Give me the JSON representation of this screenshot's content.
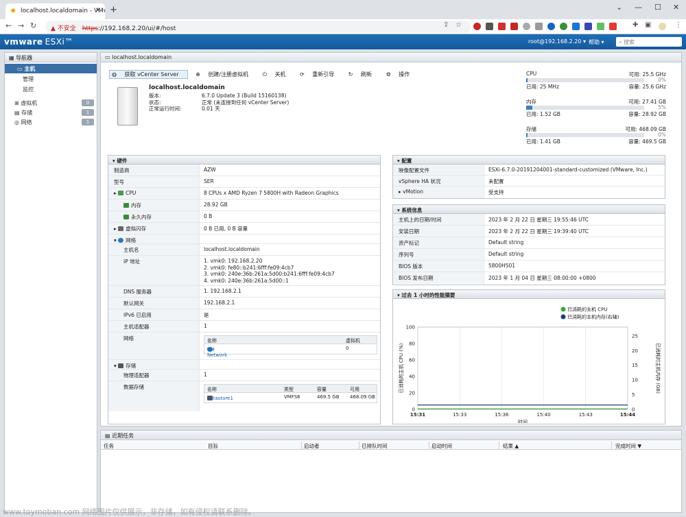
{
  "browser": {
    "tab_title": "localhost.localdomain - VMw",
    "insecure_label": "不安全",
    "url_scheme": "https",
    "url_rest": "://192.168.2.20/ui/#/host"
  },
  "header": {
    "logo": "vmware",
    "product": "ESXi™",
    "user": "root@192.168.2.20 ▾",
    "help": "帮助 ▾",
    "search_placeholder": "搜索"
  },
  "navigator": {
    "title": "导航器",
    "items": [
      {
        "label": "主机"
      },
      {
        "label": "管理"
      },
      {
        "label": "监控"
      }
    ],
    "groups": [
      {
        "label": "虚拟机",
        "count": "0"
      },
      {
        "label": "存储",
        "count": "1"
      },
      {
        "label": "网络",
        "count": "1"
      }
    ]
  },
  "main": {
    "title": "localhost.localdomain",
    "toolbar": [
      "获取 vCenter Server",
      "创建/注册虚拟机",
      "关机",
      "重新引导",
      "刷新",
      "操作"
    ],
    "host": {
      "name": "localhost.localdomain",
      "version_key": "版本:",
      "version": "6.7.0 Update 3 (Build 15160138)",
      "state_key": "状态:",
      "state": "正常 (未连接到任何 vCenter Server)",
      "uptime_key": "正常运行时间:",
      "uptime": "0.01 天"
    },
    "resources": [
      {
        "name": "CPU",
        "free": "可用: 25.5 GHz",
        "used": "已用: 25 MHz",
        "capacity": "容量: 25.6 GHz",
        "pct": "0%",
        "fraction": 0.01
      },
      {
        "name": "内存",
        "free": "可用: 27.41 GB",
        "used": "已用: 1.52 GB",
        "capacity": "容量: 28.92 GB",
        "pct": "5%",
        "fraction": 0.05
      },
      {
        "name": "存储",
        "free": "可用: 468.09 GB",
        "used": "已用: 1.41 GB",
        "capacity": "容量: 469.5 GB",
        "pct": "0%",
        "fraction": 0.01
      }
    ]
  },
  "hardware": {
    "title": "硬件",
    "rows": [
      [
        "制造商",
        "AZW"
      ],
      [
        "型号",
        "SER"
      ],
      [
        "CPU",
        "8 CPUs x AMD Ryzen 7 5800H with Radeon Graphics"
      ],
      [
        "内存",
        "28.92 GB"
      ],
      [
        "永久内存",
        "0 B"
      ],
      [
        "虚拟闪存",
        "0 B 已用, 0 B 容量"
      ],
      [
        "网络",
        ""
      ],
      [
        "主机名",
        "localhost.localdomain"
      ]
    ],
    "ip_key": "IP 地址",
    "ips": [
      "1. vmk0: 192.168.2.20",
      "2. vmk0: fe80::b241:6fff:fe09:4cb7",
      "3. vmk0: 240e:36b:261a:5d00:b241:6fff:fe09:4cb7",
      "4. vmk0: 240e:36b:261a:5d00::1"
    ],
    "rows2": [
      [
        "DNS 服务器",
        "1. 192.168.2.1"
      ],
      [
        "默认网关",
        "192.168.2.1"
      ],
      [
        "IPv6 已启用",
        "是"
      ],
      [
        "主机适配器",
        "1"
      ]
    ],
    "net_key": "网络",
    "net_cols": [
      "名称",
      "虚拟机"
    ],
    "net_row": [
      "VM Network",
      "0"
    ],
    "storage_key": "存储",
    "phys_key": "物理适配器",
    "phys": "1",
    "ds_key": "数据存储",
    "ds_cols": [
      "名称",
      "类型",
      "容量",
      "可用"
    ],
    "ds_row": [
      "datastore1",
      "VMFS6",
      "469.5 GB",
      "468.09 GB"
    ]
  },
  "config": {
    "title": "配置",
    "rows": [
      [
        "映像配置文件",
        "ESXi-6.7.0-20191204001-standard-customized (VMware, Inc.)"
      ],
      [
        "vSphere HA 状况",
        "未配置"
      ],
      [
        "vMotion",
        "受支持"
      ]
    ]
  },
  "sysinfo": {
    "title": "系统信息",
    "rows": [
      [
        "主机上的日期/时间",
        "2023 年 2 月 22 日 星期三 19:55:46 UTC"
      ],
      [
        "安装日期",
        "2023 年 2 月 22 日 星期三 19:39:40 UTC"
      ],
      [
        "资产标记",
        "Default string"
      ],
      [
        "序列号",
        "Default string"
      ],
      [
        "BIOS 版本",
        "5800H501"
      ],
      [
        "BIOS 发布日期",
        "2023 年 1 月 04 日 星期三 08:00:00 +0800"
      ]
    ]
  },
  "perf": {
    "title": "过去 1 小时的性能摘要"
  },
  "chart_data": {
    "type": "line",
    "title": "",
    "xlabel": "时间",
    "ylabel": "已消耗的主机 CPU (%)",
    "y2label": "已消耗的主机内存 (GB)",
    "x": [
      "15:31",
      "15:33",
      "15:36",
      "15:40",
      "15:43",
      "15:44"
    ],
    "ylim": [
      0,
      100
    ],
    "y2lim": [
      0,
      28
    ],
    "yticks": [
      "100",
      "80",
      "60",
      "40",
      "20",
      "0"
    ],
    "y2ticks": [
      "25",
      "20",
      "15",
      "10",
      "5",
      "0"
    ],
    "series": [
      {
        "name": "已消耗的主机 CPU",
        "color": "#3aa53a",
        "values": [
          0.5,
          0.5,
          0.5,
          0.5,
          0.5,
          0.5
        ]
      },
      {
        "name": "已消耗的主机内存(右轴)",
        "color": "#1f3f7a",
        "values": [
          1.5,
          1.5,
          1.5,
          1.5,
          1.5,
          1.5
        ]
      }
    ]
  },
  "tasks": {
    "title": "近期任务",
    "columns": [
      "任务",
      "目标",
      "启动者",
      "已排队时间",
      "启动时间",
      "结果 ▲",
      "完成时间 ▼"
    ]
  },
  "watermark": "www.toymoban.com 网络图片仅供展示，非存储，如有侵权请联系删除。"
}
